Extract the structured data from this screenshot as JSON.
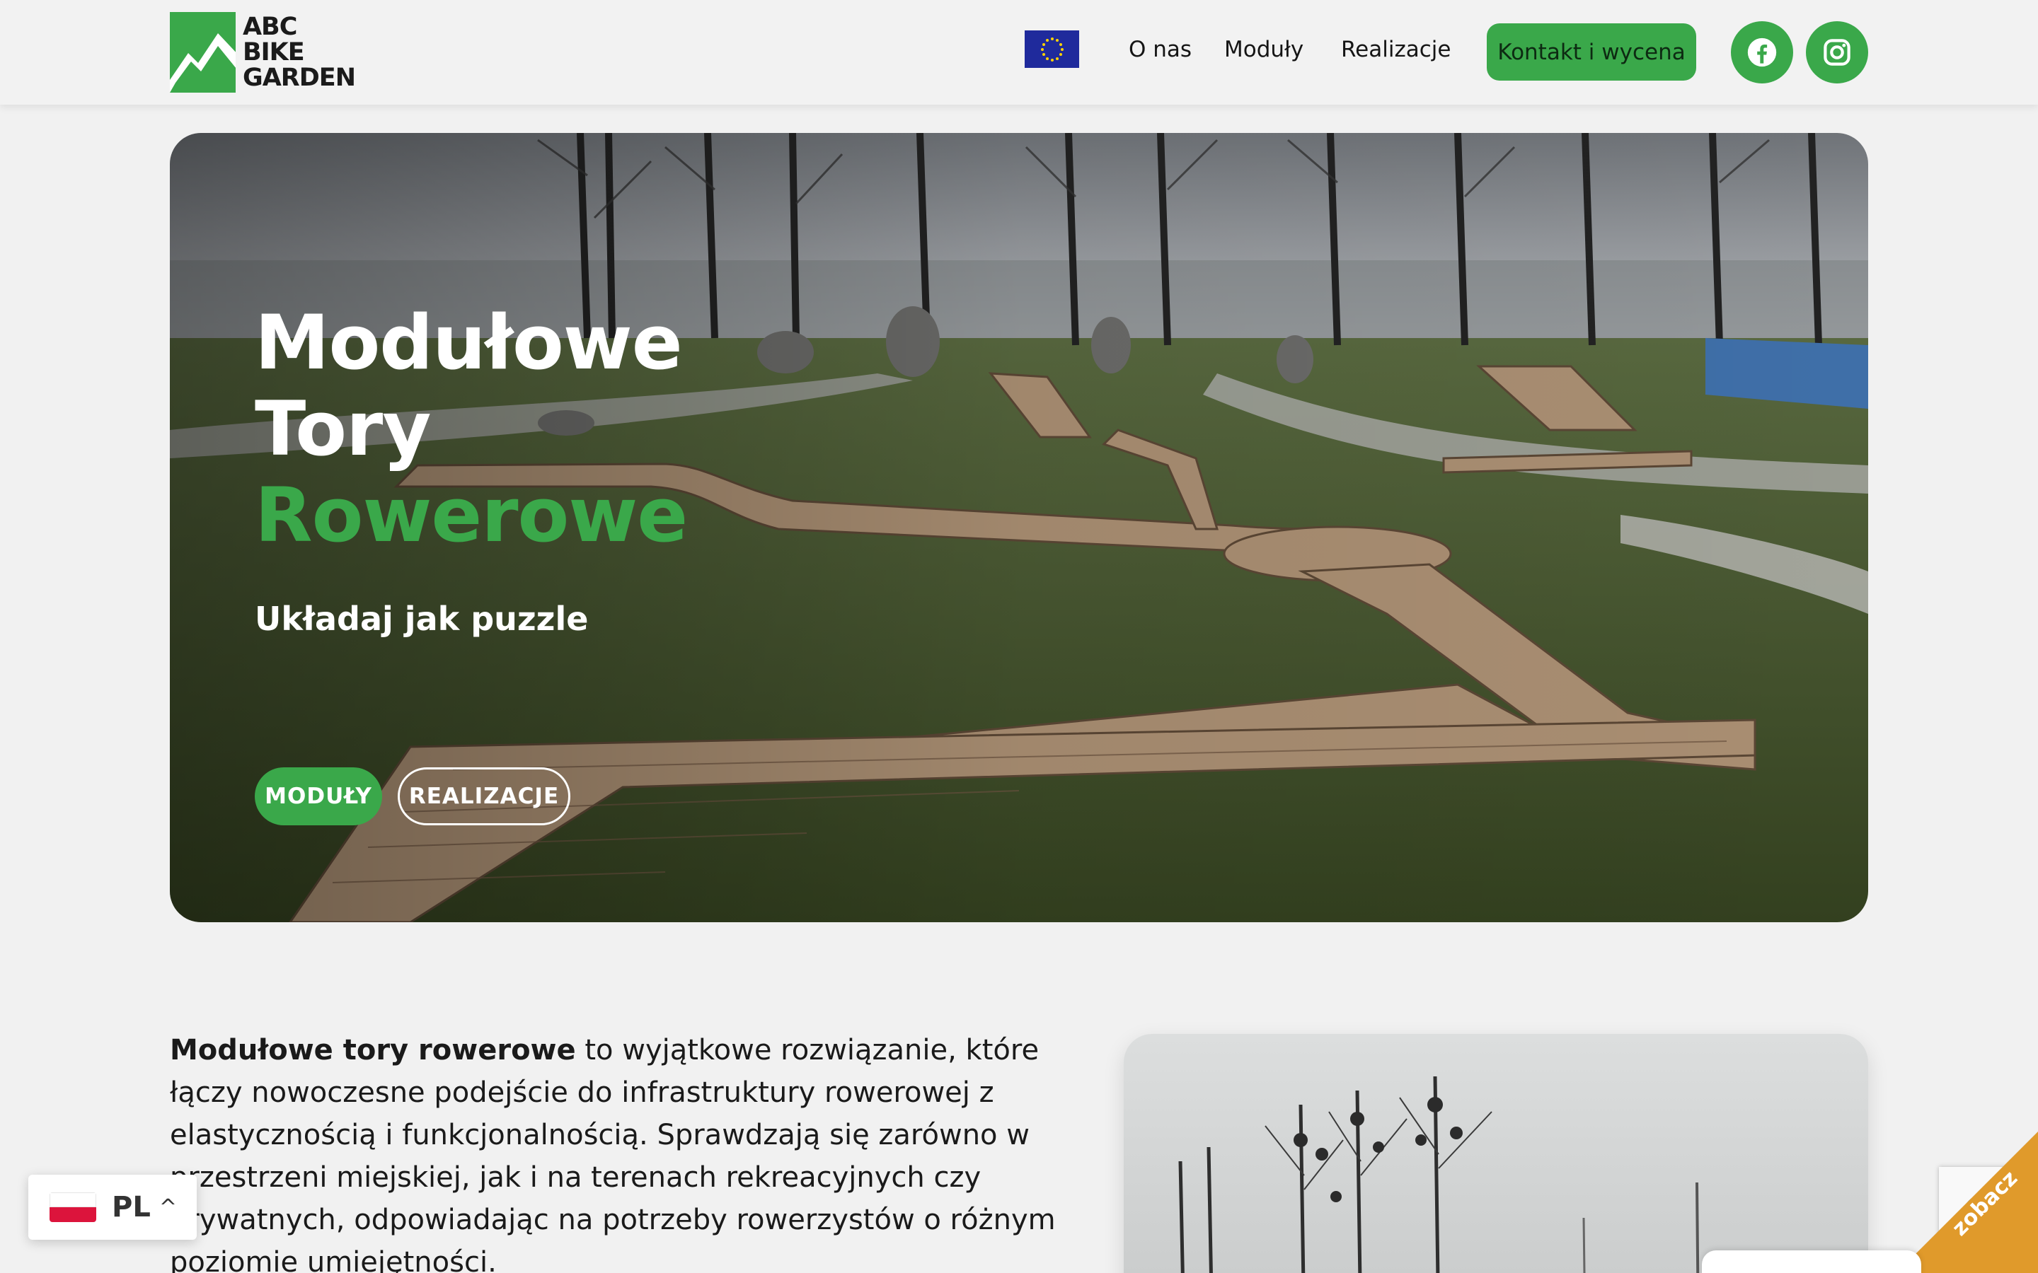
{
  "header": {
    "logo_text": "ABC\nBIKE\nGARDEN",
    "nav": [
      {
        "label": "O nas"
      },
      {
        "label": "Moduły"
      },
      {
        "label": "Realizacje"
      }
    ],
    "cta_label": "Kontakt i wycena",
    "social": [
      {
        "icon": "facebook-icon"
      },
      {
        "icon": "instagram-icon"
      }
    ],
    "accent_color": "#3aa84a"
  },
  "hero": {
    "title_line1": "Modułowe",
    "title_line2": "Tory",
    "title_line3": "Rowerowe",
    "subtitle": "Układaj jak puzzle",
    "btn_primary": "MODUŁY",
    "btn_secondary": "REALIZACJE"
  },
  "intro": {
    "lead_bold": "Modułowe tory rowerowe",
    "text": " to wyjątkowe rozwiązanie, które łączy nowoczesne podejście do infrastruktury rowerowej z elastycznością i funkcjonalnością. Sprawdzają się zarówno w przestrzeni miejskiej, jak i na terenach rekreacyjnych czy prywatnych, odpowiadając na potrzeby rowerzystów o różnym poziomie umiejętności."
  },
  "language": {
    "code": "PL",
    "chevron": "^"
  },
  "corner_label": "zobacz"
}
